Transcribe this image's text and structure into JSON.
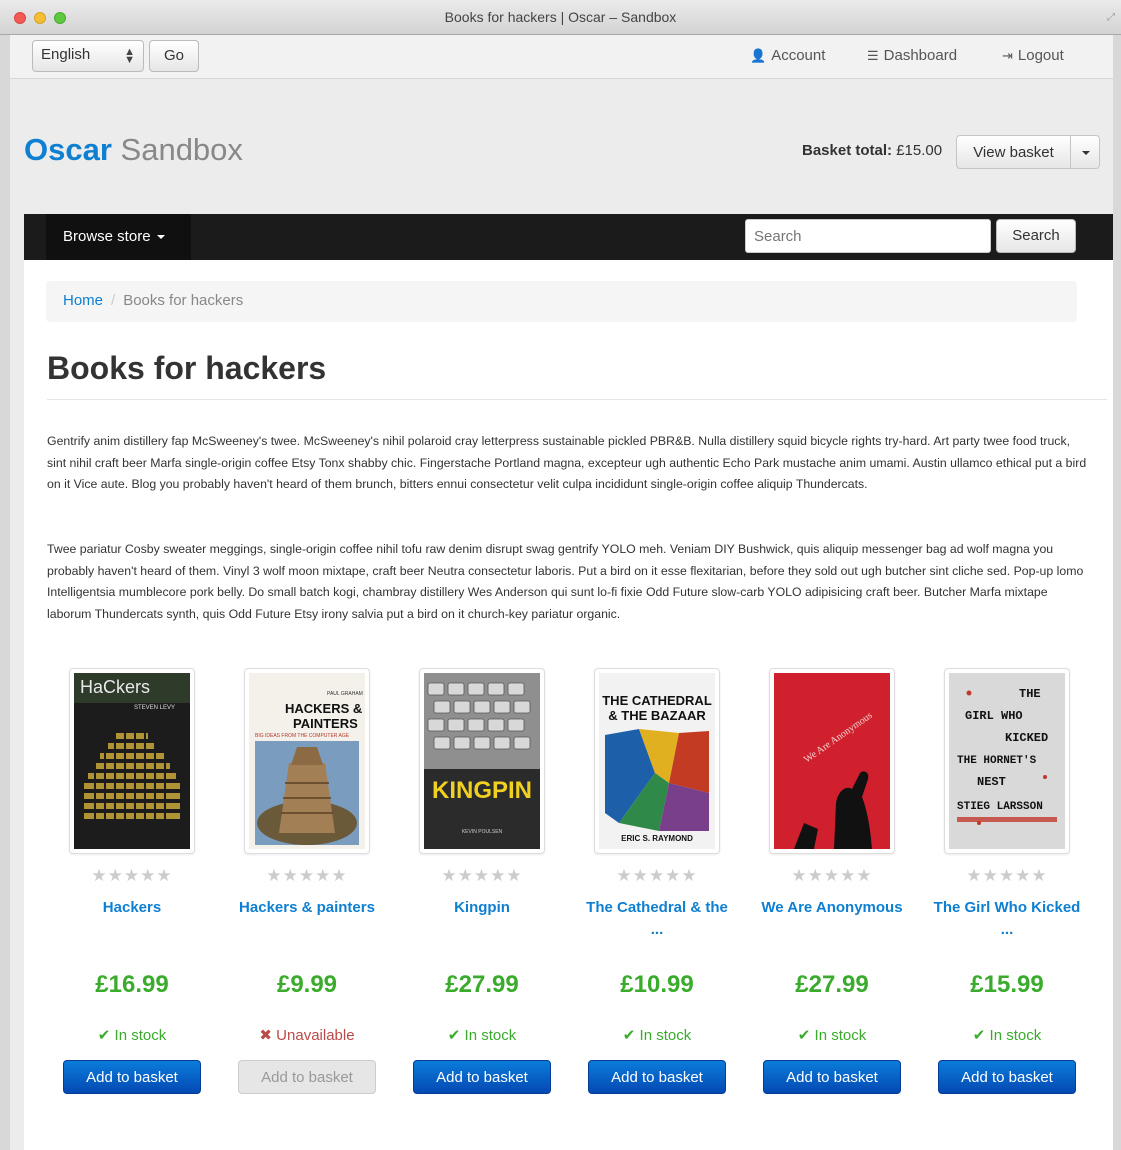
{
  "window": {
    "title": "Books for hackers | Oscar – Sandbox"
  },
  "topbar": {
    "language": "English",
    "go_label": "Go",
    "account_label": "Account",
    "dashboard_label": "Dashboard",
    "logout_label": "Logout"
  },
  "header": {
    "brand_primary": "Oscar",
    "brand_secondary": "Sandbox",
    "basket_total_label": "Basket total:",
    "basket_total_value": "£15.00",
    "view_basket_label": "View basket"
  },
  "nav": {
    "browse_label": "Browse store",
    "search_placeholder": "Search",
    "search_button": "Search"
  },
  "breadcrumb": {
    "home": "Home",
    "separator": "/",
    "current": "Books for hackers"
  },
  "page": {
    "title": "Books for hackers",
    "paragraph_1": "Gentrify anim distillery fap McSweeney's twee. McSweeney's nihil polaroid cray letterpress sustainable pickled PBR&B. Nulla distillery squid bicycle rights try-hard. Art party twee food truck, sint nihil craft beer Marfa single-origin coffee Etsy Tonx shabby chic. Fingerstache Portland magna, excepteur ugh authentic Echo Park mustache anim umami. Austin ullamco ethical put a bird on it Vice aute. Blog you probably haven't heard of them brunch, bitters ennui consectetur velit culpa incididunt single-origin coffee aliquip Thundercats.",
    "paragraph_2": "Twee pariatur Cosby sweater meggings, single-origin coffee nihil tofu raw denim disrupt swag gentrify YOLO meh. Veniam DIY Bushwick, quis aliquip messenger bag ad wolf magna you probably haven't heard of them. Vinyl 3 wolf moon mixtape, craft beer Neutra consectetur laboris. Put a bird on it esse flexitarian, before they sold out ugh butcher sint cliche sed. Pop-up lomo Intelligentsia mumblecore pork belly. Do small batch kogi, chambray distillery Wes Anderson qui sunt lo-fi fixie Odd Future slow-carb YOLO adipisicing craft beer. Butcher Marfa mixtape laborum Thundercats synth, quis Odd Future Etsy irony salvia put a bird on it church-key pariatur organic."
  },
  "products": [
    {
      "name": "Hackers",
      "price": "£16.99",
      "availability": "In stock",
      "available": true,
      "button": "Add to basket",
      "rating": "★★★★★",
      "cover": {
        "title": "HaCkers",
        "subtitle": "STEVEN LEVY",
        "bg": "#1c1c1c",
        "accent": "#c9a83a"
      }
    },
    {
      "name": "Hackers & painters",
      "price": "£9.99",
      "availability": "Unavailable",
      "available": false,
      "button": "Add to basket",
      "rating": "★★★★★",
      "cover": {
        "author": "PAUL GRAHAM",
        "title_1": "HACKERS &",
        "title_2": "PAINTERS",
        "tagline": "BIG IDEAS FROM THE COMPUTER AGE",
        "bg": "#f4f1ea",
        "accent": "#b03a2e"
      }
    },
    {
      "name": "Kingpin",
      "price": "£27.99",
      "availability": "In stock",
      "available": true,
      "button": "Add to basket",
      "rating": "★★★★★",
      "cover": {
        "title": "KINGPIN",
        "author": "KEVIN POULSEN",
        "bg": "#2b2b2b",
        "accent": "#f0d020"
      }
    },
    {
      "name": "The Cathedral & the ...",
      "price": "£10.99",
      "availability": "In stock",
      "available": true,
      "button": "Add to basket",
      "rating": "★★★★★",
      "cover": {
        "title_1": "THE CATHEDRAL",
        "title_2": "& THE BAZAAR",
        "author": "ERIC S. RAYMOND",
        "bg": "#f2f2f2",
        "accent": "#1d5fa8"
      }
    },
    {
      "name": "We Are Anonymous",
      "price": "£27.99",
      "availability": "In stock",
      "available": true,
      "button": "Add to basket",
      "rating": "★★★★★",
      "cover": {
        "title": "We Are Anonymous",
        "bg": "#d0202e",
        "accent": "#111111"
      }
    },
    {
      "name": "The Girl Who Kicked ...",
      "price": "£15.99",
      "availability": "In stock",
      "available": true,
      "button": "Add to basket",
      "rating": "★★★★★",
      "cover": {
        "line_1": "THE",
        "line_2": "GIRL WHO",
        "line_3": "KICKED",
        "line_4": "THE HORNET'S",
        "line_5": "NEST",
        "author": "STIEG LARSSON",
        "bg": "#d9d9d9",
        "accent": "#c0392b"
      }
    }
  ],
  "colors": {
    "brand_blue": "#0e7fd1",
    "price_green": "#3aab2c",
    "unavailable_red": "#b94a48",
    "navbar_black": "#1b1b1b",
    "button_blue": "#0449b3"
  }
}
